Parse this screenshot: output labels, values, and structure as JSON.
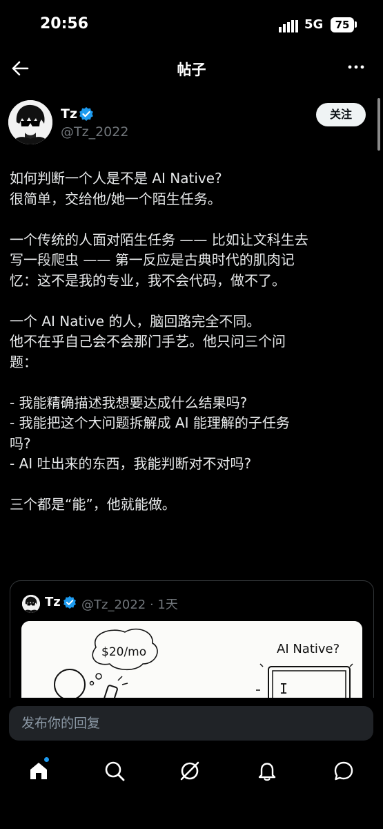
{
  "status_bar": {
    "time": "20:56",
    "network": "5G",
    "battery": "75"
  },
  "header": {
    "title": "帖子",
    "back_icon": "arrow-left-icon",
    "more_icon": "more-icon"
  },
  "post": {
    "author_name": "Tz",
    "author_handle": "@Tz_2022",
    "follow_label": "关注",
    "paragraphs": [
      [
        "如何判断一个人是不是 AI Native?",
        "很简单，交给他/她一个陌生任务。"
      ],
      [
        "一个传统的人面对陌生任务 —— 比如让文科生去",
        "写一段爬虫 —— 第一反应是古典时代的肌肉记",
        "忆：这不是我的专业，我不会代码，做不了。"
      ],
      [
        "一个 AI Native 的人，脑回路完全不同。",
        "他不在乎自己会不会那门手艺。他只问三个问",
        "题："
      ],
      [
        "- 我能精确描述我想要达成什么结果吗?",
        "- 我能把这个大问题拆解成 AI 能理解的子任务",
        "吗?",
        "- AI 吐出来的东西，我能判断对不对吗?"
      ],
      [
        "三个都是“能”，他就能做。"
      ]
    ]
  },
  "quoted": {
    "author_name": "Tz",
    "meta": "@Tz_2022 · 1天",
    "image": {
      "price_text": "$20/mo",
      "screen_title": "AI Native?",
      "cursor": "I"
    }
  },
  "reply": {
    "placeholder": "发布你的回复"
  },
  "bottom_nav": {
    "items": [
      {
        "icon": "home-icon",
        "active": true
      },
      {
        "icon": "search-icon",
        "active": false
      },
      {
        "icon": "grok-icon",
        "active": false
      },
      {
        "icon": "bell-icon",
        "active": false
      },
      {
        "icon": "message-icon",
        "active": false
      }
    ]
  },
  "colors": {
    "background": "#000000",
    "accent": "#1d9bf0",
    "text": "#e7e9ea",
    "muted": "#71767b"
  }
}
